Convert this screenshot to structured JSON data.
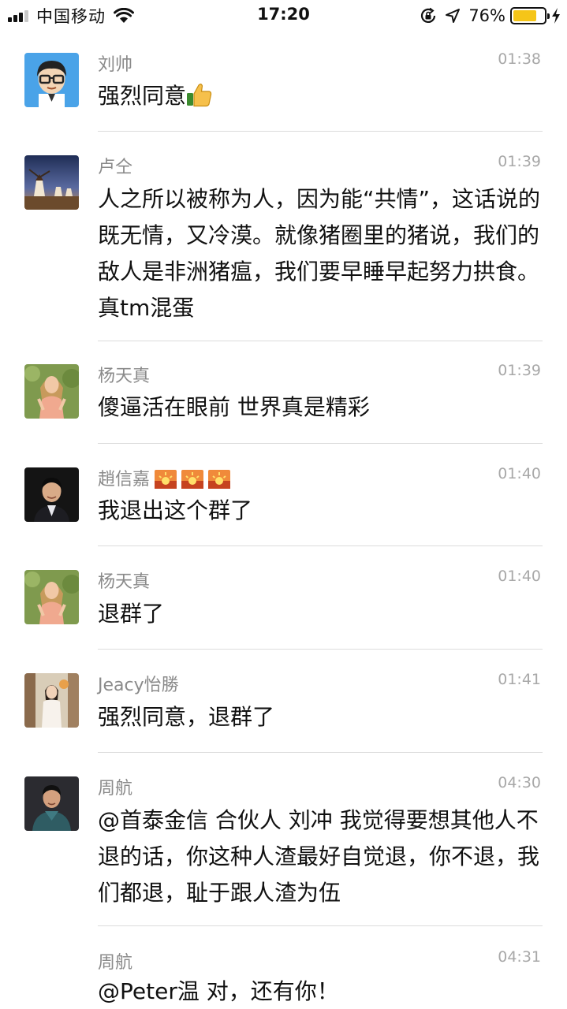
{
  "status_bar": {
    "carrier": "中国移动",
    "time": "17:20",
    "battery_percent": "76%",
    "battery_level": 0.76,
    "battery_color": "#f5c518",
    "icons": [
      "signal-icon",
      "wifi-icon",
      "rotation-lock-icon",
      "location-icon",
      "battery-icon",
      "charging-bolt-icon"
    ]
  },
  "messages": [
    {
      "name": "刘帅",
      "time": "01:38",
      "text": "强烈同意",
      "emoji": "thumbs-up-icon"
    },
    {
      "name": "卢仝",
      "time": "01:39",
      "text": "人之所以被称为人，因为能“共情”，这话说的既无情，又冷漠。就像猪圈里的猪说，我们的敌人是非洲猪瘟，我们要早睡早起努力拱食。真tm混蛋"
    },
    {
      "name": "杨天真",
      "time": "01:39",
      "text": "傻逼活在眼前 世界真是精彩"
    },
    {
      "name": "趙信嘉",
      "time": "01:40",
      "text": "我退出这个群了",
      "name_emoji": "sunrise-icon"
    },
    {
      "name": "杨天真",
      "time": "01:40",
      "text": "退群了"
    },
    {
      "name": "Jeacy怡勝",
      "time": "01:41",
      "text": "强烈同意，退群了"
    },
    {
      "name": "周航",
      "time": "04:30",
      "text": "@首泰金信 合伙人 刘冲 我觉得要想其他人不退的话，你这种人渣最好自觉退，你不退，我们都退，耻于跟人渣为伍"
    },
    {
      "name": "周航",
      "time": "04:31",
      "text": "@Peter温 对，还有你！"
    }
  ]
}
